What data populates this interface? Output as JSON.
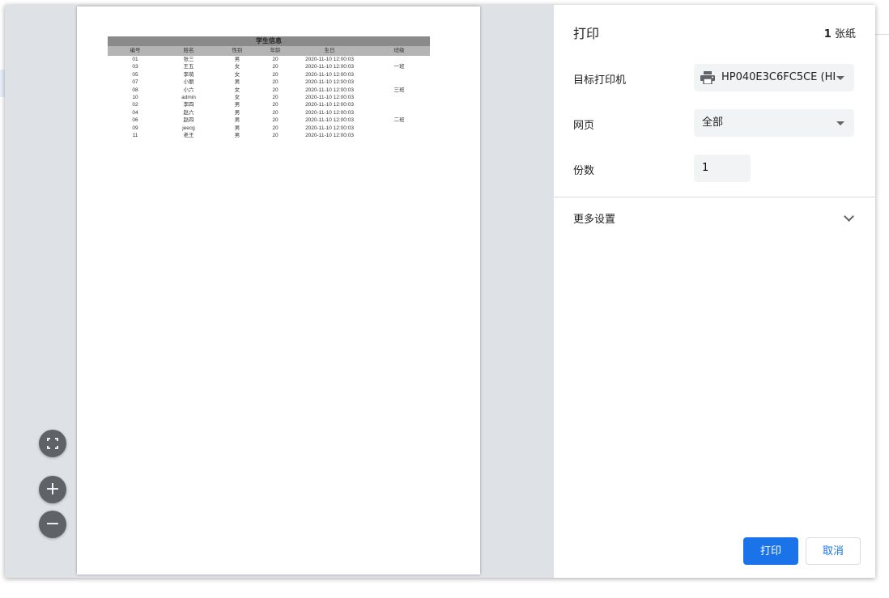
{
  "panel": {
    "title": "打印",
    "sheet_count": "1",
    "sheet_unit": "张纸",
    "printer_label": "目标打印机",
    "printer_value": "HP040E3C6FC5CE (HI",
    "pages_label": "网页",
    "pages_value": "全部",
    "copies_label": "份数",
    "copies_value": "1",
    "more_settings": "更多设置",
    "print_button": "打印",
    "cancel_button": "取消"
  },
  "report": {
    "title": "学生信息",
    "columns": [
      "编号",
      "姓名",
      "性别",
      "年龄",
      "生日",
      "班级"
    ],
    "rows": [
      [
        "01",
        "张三",
        "男",
        "20",
        "2020-11-10 12:00:03",
        ""
      ],
      [
        "03",
        "王五",
        "女",
        "20",
        "2020-11-10 12:00:03",
        "一班"
      ],
      [
        "05",
        "李萌",
        "女",
        "20",
        "2020-11-10 12:00:03",
        ""
      ],
      [
        "07",
        "小丽",
        "男",
        "20",
        "2020-11-10 12:00:03",
        ""
      ],
      [
        "08",
        "小六",
        "女",
        "20",
        "2020-11-10 12:00:03",
        "三班"
      ],
      [
        "10",
        "admin",
        "女",
        "20",
        "2020-11-10 12:00:03",
        ""
      ],
      [
        "02",
        "李四",
        "男",
        "20",
        "2020-11-10 12:00:03",
        ""
      ],
      [
        "04",
        "赵六",
        "男",
        "20",
        "2020-11-10 12:00:03",
        ""
      ],
      [
        "06",
        "赵四",
        "男",
        "20",
        "2020-11-10 12:00:03",
        "二班"
      ],
      [
        "09",
        "jeecg",
        "男",
        "20",
        "2020-11-10 12:00:03",
        ""
      ],
      [
        "11",
        "老王",
        "男",
        "20",
        "2020-11-10 12:00:03",
        ""
      ]
    ]
  },
  "zoom_controls": {
    "fit_icon": "fit-to-page-icon",
    "zoom_in_icon": "plus-icon",
    "zoom_out_icon": "minus-icon"
  },
  "colors": {
    "accent": "#1a73e8",
    "preview_bg": "#dee1e6",
    "field_bg": "#f1f3f4"
  }
}
